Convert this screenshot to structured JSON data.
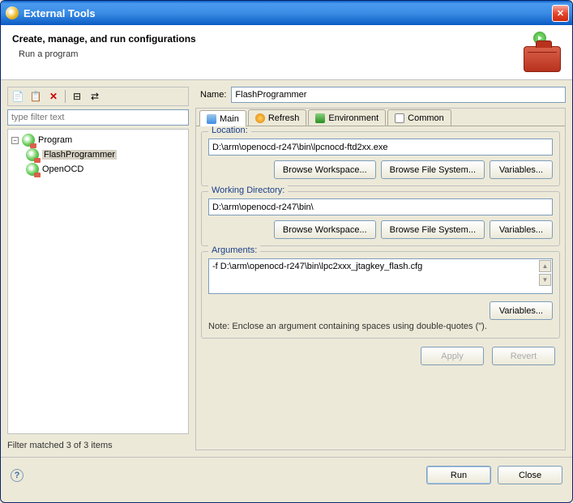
{
  "title": "External Tools",
  "header": {
    "heading": "Create, manage, and run configurations",
    "sub": "Run a program"
  },
  "toolbar": {
    "new_icon": "📄",
    "copy_icon": "📋",
    "delete_icon": "✕",
    "collapse_icon": "⊟",
    "filter_icon": "⇄"
  },
  "filter_placeholder": "type filter text",
  "tree": {
    "root": "Program",
    "items": [
      "FlashProgrammer",
      "OpenOCD"
    ]
  },
  "filter_status": "Filter matched 3 of 3 items",
  "name_label": "Name:",
  "name_value": "FlashProgrammer",
  "tabs": [
    "Main",
    "Refresh",
    "Environment",
    "Common"
  ],
  "groups": {
    "location": {
      "legend": "Location:",
      "value": "D:\\arm\\openocd-r247\\bin\\lpcnocd-ftd2xx.exe",
      "buttons": [
        "Browse Workspace...",
        "Browse File System...",
        "Variables..."
      ]
    },
    "working_dir": {
      "legend": "Working Directory:",
      "value": "D:\\arm\\openocd-r247\\bin\\",
      "buttons": [
        "Browse Workspace...",
        "Browse File System...",
        "Variables..."
      ]
    },
    "arguments": {
      "legend": "Arguments:",
      "value": "-f D:\\arm\\openocd-r247\\bin\\lpc2xxx_jtagkey_flash.cfg",
      "button": "Variables...",
      "note": "Note: Enclose an argument containing spaces using double-quotes (\")."
    }
  },
  "apply_label": "Apply",
  "revert_label": "Revert",
  "run_label": "Run",
  "close_label": "Close"
}
